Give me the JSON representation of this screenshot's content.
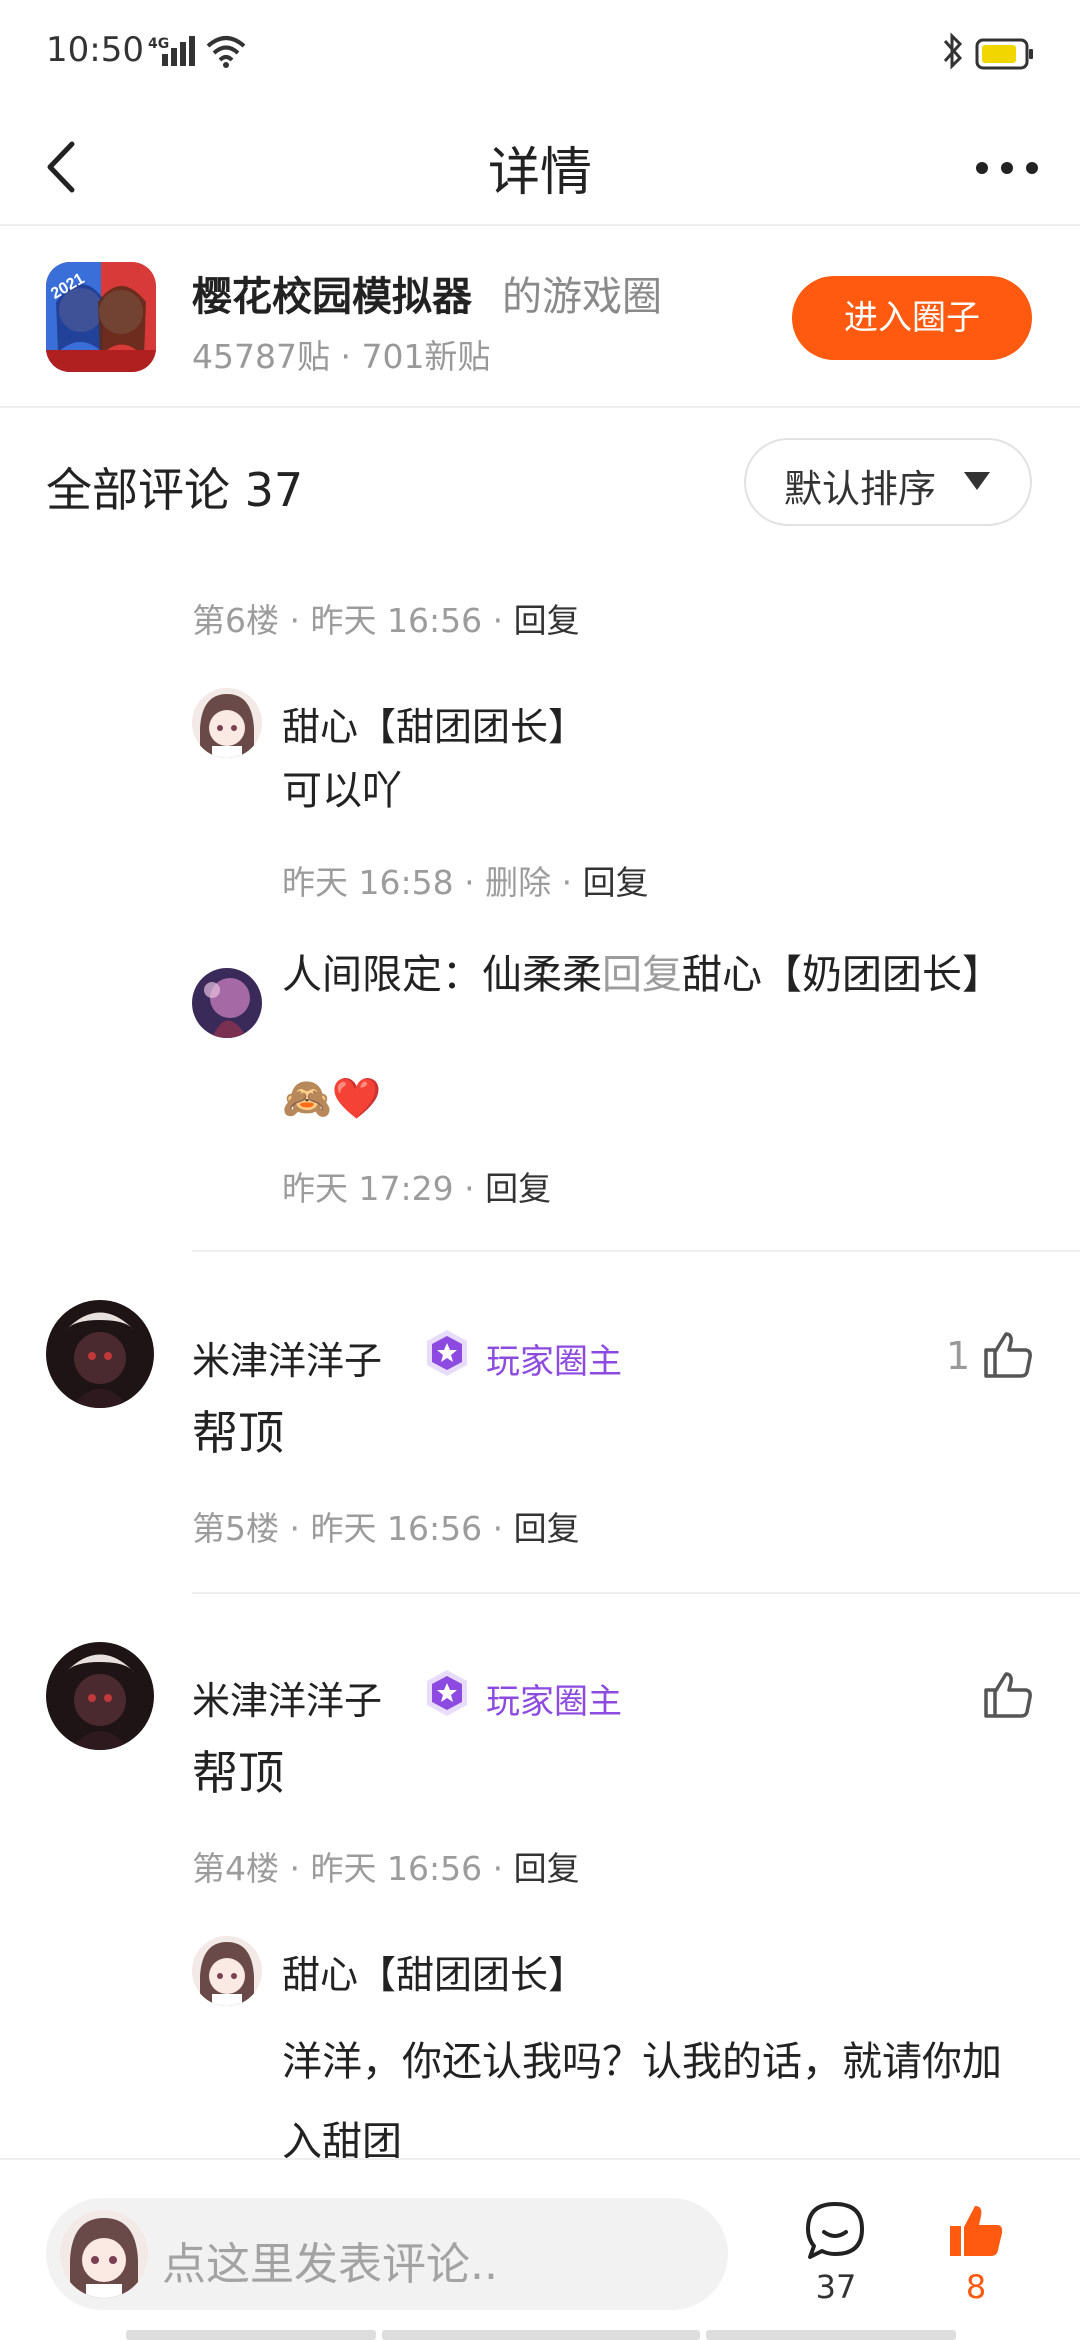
{
  "status_bar": {
    "time": "10:50",
    "network": "4G"
  },
  "header": {
    "title": "详情"
  },
  "circle": {
    "name": "樱花校园模拟器",
    "suffix": "的游戏圈",
    "stats": "45787贴 · 701新贴",
    "enter_label": "进入圈子",
    "icon_text": "2021"
  },
  "comments_header": {
    "title": "全部评论 37",
    "sort_label": "默认排序"
  },
  "meta_sep": " · ",
  "reply_label": "回复",
  "delete_label": "删除",
  "comments": [
    {
      "floor": "第6楼",
      "time": "昨天 16:56",
      "replies": [
        {
          "user": "甜心【甜团团长】",
          "text": "可以吖",
          "time": "昨天 16:58"
        },
        {
          "user": "人间限定：仙柔柔",
          "reply_word": "回复",
          "target": "甜心【奶团团长】",
          "text": "🙈❤️",
          "time": "昨天 17:29"
        }
      ]
    },
    {
      "user": "米津洋洋子",
      "badge": "玩家圈主",
      "text": "帮顶",
      "floor": "第5楼",
      "time": "昨天 16:56",
      "likes": "1"
    },
    {
      "user": "米津洋洋子",
      "badge": "玩家圈主",
      "text": "帮顶",
      "floor": "第4楼",
      "time": "昨天 16:56",
      "replies": [
        {
          "user": "甜心【甜团团长】",
          "text": "洋洋，你还认我吗？认我的话，就请你加入甜团"
        }
      ]
    }
  ],
  "bottom_bar": {
    "placeholder": "点这里发表评论..",
    "comment_count": "37",
    "like_count": "8"
  },
  "colors": {
    "accent": "#ff5a0f",
    "badge_purple": "#8d4ae0"
  }
}
